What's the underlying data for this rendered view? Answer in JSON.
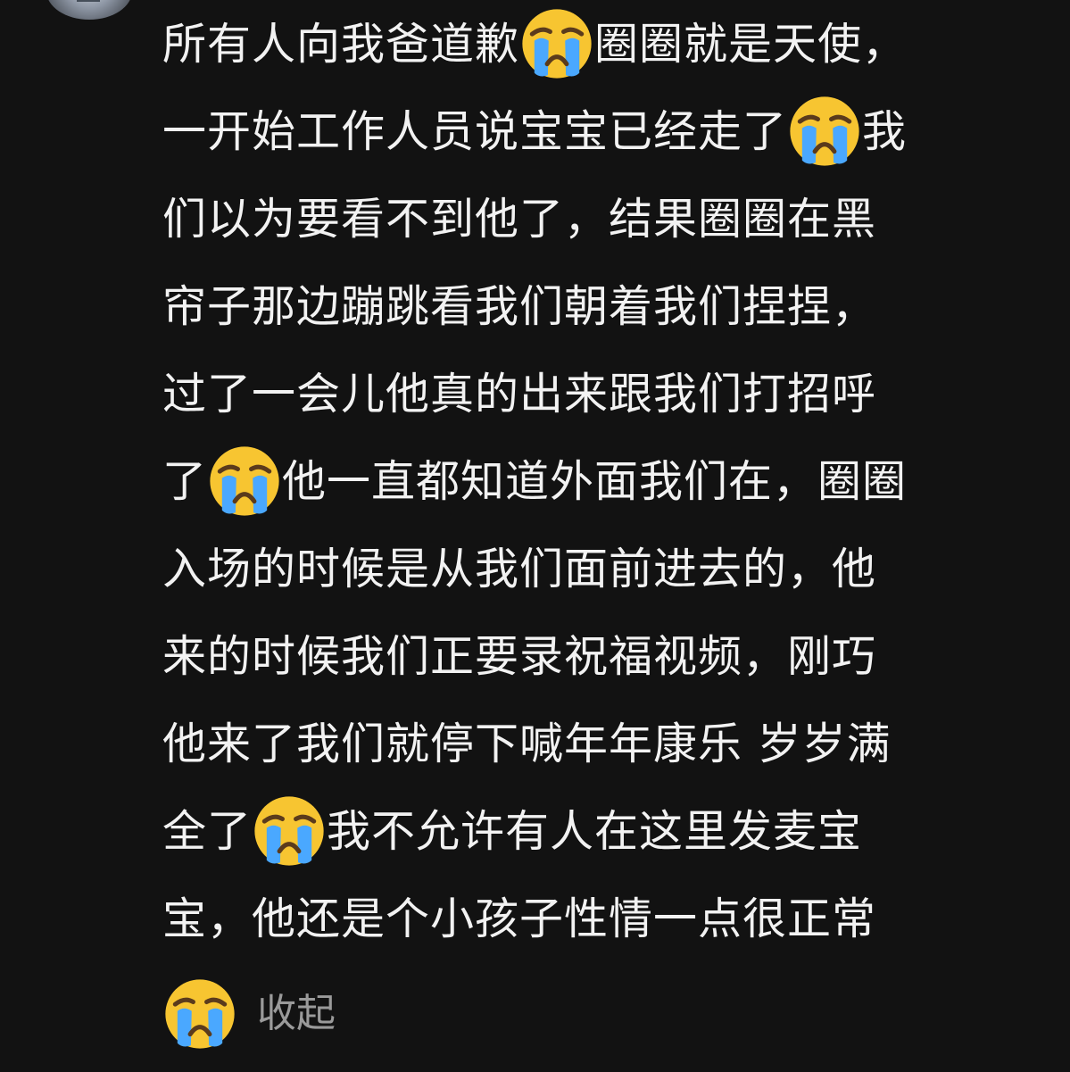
{
  "comment": {
    "lines": [
      [
        "所有人向我爸道歉",
        "圈圈就是天使，"
      ],
      [
        "一开始工作人员说宝宝已经走了",
        "我"
      ],
      [
        "们以为要看不到他了，结果圈圈在黑"
      ],
      [
        "帘子那边蹦跳看我们朝着我们捏捏，"
      ],
      [
        "过了一会儿他真的出来跟我们打招呼"
      ],
      [
        "了",
        "他一直都知道外面我们在，圈圈"
      ],
      [
        "入场的时候是从我们面前进去的，他"
      ],
      [
        "来的时候我们正要录祝福视频，刚巧"
      ],
      [
        "他来了我们就停下喊年年康乐 岁岁满"
      ],
      [
        "全了",
        "我不允许有人在这里发麦宝"
      ],
      [
        "宝，他还是个小孩子性情一点很正常"
      ]
    ],
    "emoji_name": "crying-face-icon",
    "collapse_label": "收起"
  },
  "colors": {
    "background": "#121212",
    "text": "#f2f2f2",
    "muted": "#9a9a9a",
    "emoji_yellow": "#f7c531",
    "emoji_blue": "#4aa8ff"
  }
}
